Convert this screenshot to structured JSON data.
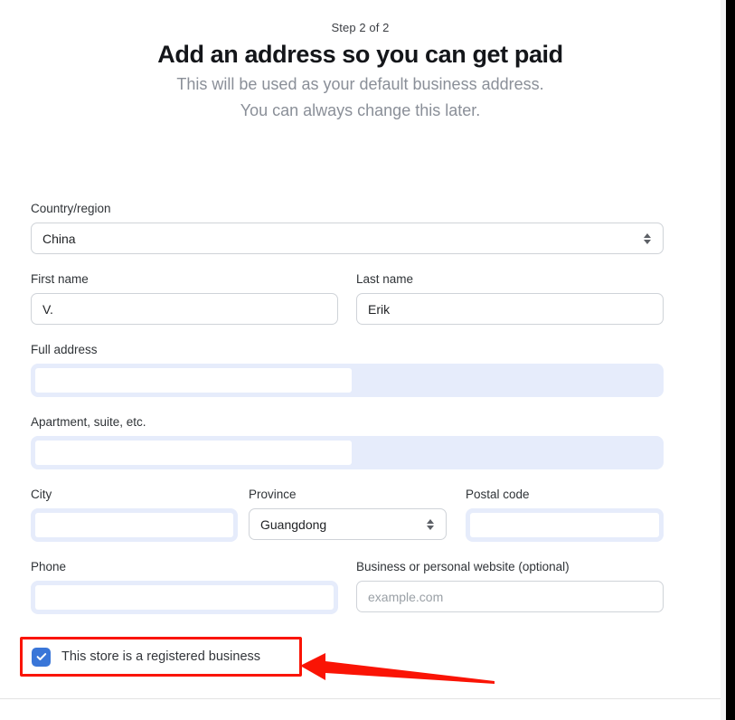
{
  "header": {
    "step": "Step 2 of 2",
    "title": "Add an address so you can get paid",
    "subtitle_line1": "This will be used as your default business address.",
    "subtitle_line2": "You can always change this later."
  },
  "form": {
    "country": {
      "label": "Country/region",
      "value": "China",
      "icon": "stepper-updown-icon"
    },
    "first_name": {
      "label": "First name",
      "value": "V."
    },
    "last_name": {
      "label": "Last name",
      "value": "Erik"
    },
    "full_address": {
      "label": "Full address",
      "value": ""
    },
    "apartment": {
      "label": "Apartment, suite, etc.",
      "value": ""
    },
    "city": {
      "label": "City",
      "value": ""
    },
    "province": {
      "label": "Province",
      "value": "Guangdong",
      "icon": "stepper-updown-icon"
    },
    "postal_code": {
      "label": "Postal code",
      "value": ""
    },
    "phone": {
      "label": "Phone",
      "value": ""
    },
    "website": {
      "label": "Business or personal website (optional)",
      "value": "",
      "placeholder": "example.com"
    },
    "registered_business": {
      "label": "This store is a registered business",
      "checked": true,
      "icon": "checkmark-icon"
    }
  },
  "annotations": {
    "highlight_color": "#fa1405",
    "arrow_color": "#fa1405",
    "arrow_direction": "left"
  },
  "colors": {
    "accent_blue": "#3a76d8",
    "focus_halo": "#e6ecfb",
    "border_gray": "#cfd3d8",
    "title_text": "#14161a",
    "subtitle_text": "#8a8f98"
  }
}
